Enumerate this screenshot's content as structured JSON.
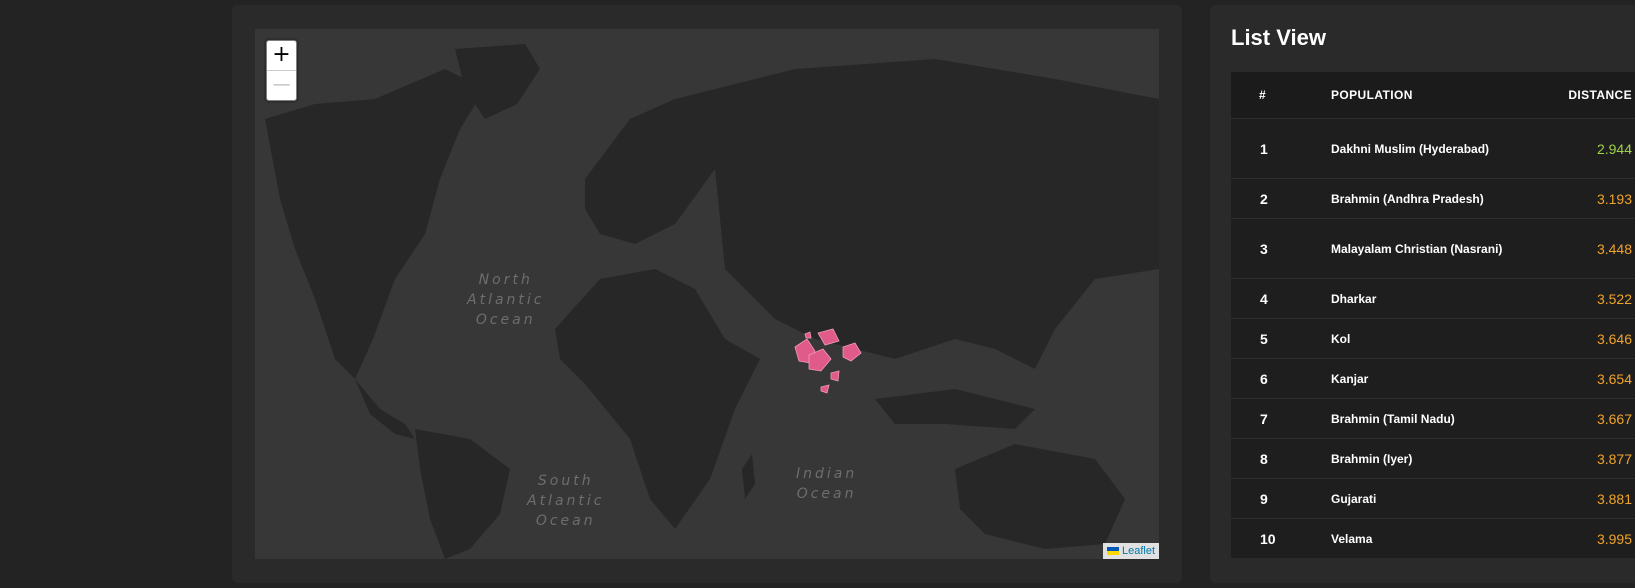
{
  "map": {
    "zoom_in_label": "+",
    "zoom_out_label": "—",
    "oceans": {
      "north_atlantic": [
        "North",
        "Atlantic",
        "Ocean"
      ],
      "south_atlantic": [
        "South",
        "Atlantic",
        "Ocean"
      ],
      "indian": [
        "Indian",
        "Ocean"
      ]
    },
    "attribution": "Leaflet",
    "highlight_color": "#e05a8a"
  },
  "list": {
    "title": "List View",
    "headers": {
      "index": "#",
      "population": "POPULATION",
      "distance": "DISTANCE"
    },
    "rows": [
      {
        "index": "1",
        "population": "Dakhni Muslim (Hyderabad)",
        "distance": "2.944"
      },
      {
        "index": "2",
        "population": "Brahmin (Andhra Pradesh)",
        "distance": "3.193"
      },
      {
        "index": "3",
        "population": "Malayalam Christian (Nasrani)",
        "distance": "3.448"
      },
      {
        "index": "4",
        "population": "Dharkar",
        "distance": "3.522"
      },
      {
        "index": "5",
        "population": "Kol",
        "distance": "3.646"
      },
      {
        "index": "6",
        "population": "Kanjar",
        "distance": "3.654"
      },
      {
        "index": "7",
        "population": "Brahmin (Tamil Nadu)",
        "distance": "3.667"
      },
      {
        "index": "8",
        "population": "Brahmin (Iyer)",
        "distance": "3.877"
      },
      {
        "index": "9",
        "population": "Gujarati",
        "distance": "3.881"
      },
      {
        "index": "10",
        "population": "Velama",
        "distance": "3.995"
      }
    ]
  },
  "colors": {
    "best_distance": "#9fd14b",
    "distance": "#f0a32b"
  }
}
